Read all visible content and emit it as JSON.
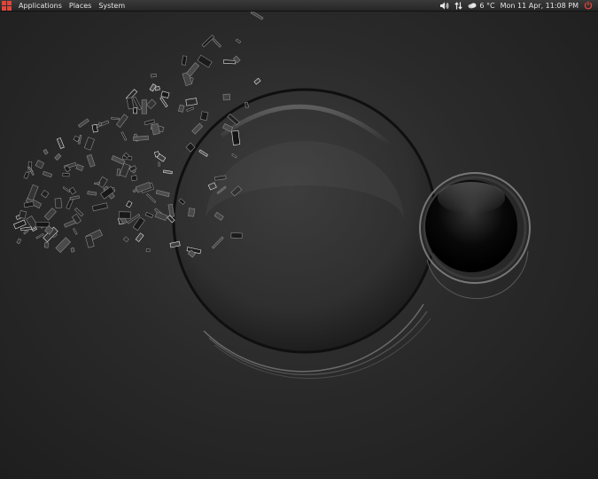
{
  "top_panel": {
    "menus": [
      {
        "label": "Applications"
      },
      {
        "label": "Places"
      },
      {
        "label": "System"
      }
    ],
    "tray": {
      "volume_icon": "volume-icon",
      "network_icon": "network-icon",
      "weather_icon": "weather-icon",
      "temperature": "6 °C",
      "datetime": "Mon 11 Apr, 11:08 PM",
      "power_icon": "power-icon"
    },
    "colors": {
      "apps_logo": "#e0453a",
      "power": "#e0453a"
    }
  },
  "desktop": {
    "wallpaper": "dark glass spheres with shattered fragments"
  }
}
